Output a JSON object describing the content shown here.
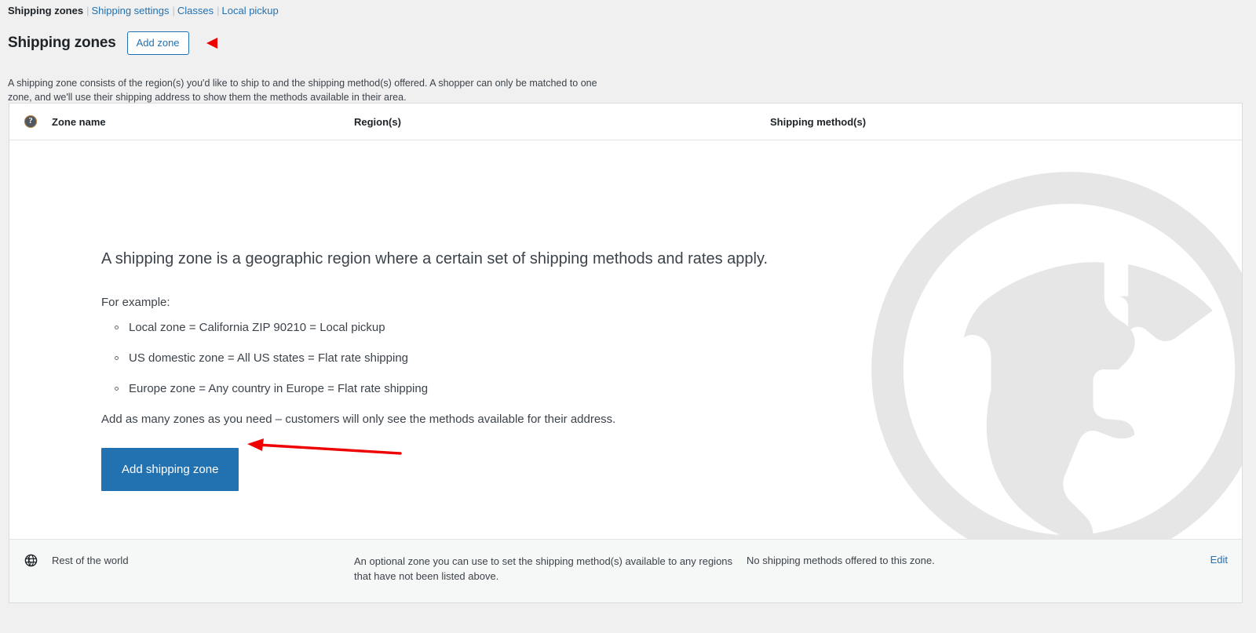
{
  "subnav": {
    "items": [
      {
        "label": "Shipping zones",
        "current": true
      },
      {
        "label": "Shipping settings",
        "current": false
      },
      {
        "label": "Classes",
        "current": false
      },
      {
        "label": "Local pickup",
        "current": false
      }
    ],
    "separator": "|"
  },
  "header": {
    "page_title": "Shipping zones",
    "add_zone_label": "Add zone",
    "description": "A shipping zone consists of the region(s) you'd like to ship to and the shipping method(s) offered. A shopper can only be matched to one zone, and we'll use their shipping address to show them the methods available in their area."
  },
  "table": {
    "help_icon_glyph": "?",
    "columns": {
      "zone_name": "Zone name",
      "regions": "Region(s)",
      "shipping_methods": "Shipping method(s)"
    }
  },
  "empty_state": {
    "lead": "A shipping zone is a geographic region where a certain set of shipping methods and rates apply.",
    "example_label": "For example:",
    "examples": [
      "Local zone = California ZIP 90210 = Local pickup",
      "US domestic zone = All US states = Flat rate shipping",
      "Europe zone = Any country in Europe = Flat rate shipping"
    ],
    "tail": "Add as many zones as you need – customers will only see the methods available for their address.",
    "cta_label": "Add shipping zone",
    "watermark_icon": "globe-watermark"
  },
  "rest_of_world_row": {
    "icon": "globe-icon",
    "zone_name": "Rest of the world",
    "regions": "An optional zone you can use to set the shipping method(s) available to any regions that have not been listed above.",
    "shipping_methods": "No shipping methods offered to this zone.",
    "edit_label": "Edit"
  },
  "annotations": {
    "small_arrow": "red-left-arrow-marker",
    "long_arrow": "red-left-arrow-pointer"
  },
  "colors": {
    "page_background": "#f0f0f1",
    "card_background": "#ffffff",
    "accent_blue": "#2271b1",
    "link_blue": "#2271b1",
    "annotation_red": "#ee0000",
    "watermark_gray": "#e5e5e5",
    "footer_row_background": "#f6f7f7"
  }
}
